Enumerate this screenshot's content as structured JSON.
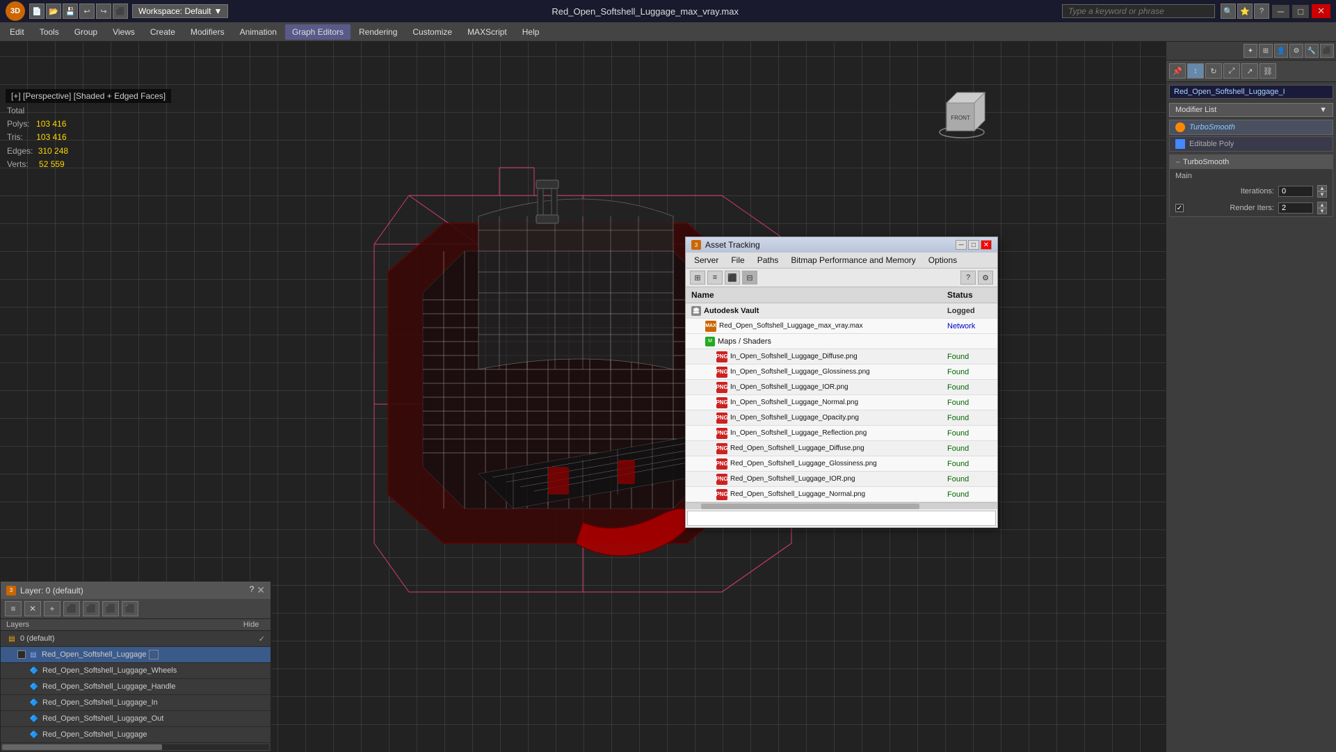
{
  "titlebar": {
    "filename": "Red_Open_Softshell_Luggage_max_vray.max",
    "workspace_label": "Workspace: Default",
    "search_placeholder": "Type a keyword or phrase",
    "min_btn": "─",
    "max_btn": "□",
    "close_btn": "✕"
  },
  "menubar": {
    "items": [
      {
        "label": "Edit",
        "active": false
      },
      {
        "label": "Tools",
        "active": false
      },
      {
        "label": "Group",
        "active": false
      },
      {
        "label": "Views",
        "active": false
      },
      {
        "label": "Create",
        "active": false
      },
      {
        "label": "Modifiers",
        "active": false
      },
      {
        "label": "Animation",
        "active": false
      },
      {
        "label": "Graph Editors",
        "active": true
      },
      {
        "label": "Rendering",
        "active": false
      },
      {
        "label": "Customize",
        "active": false
      },
      {
        "label": "MAXScript",
        "active": false
      },
      {
        "label": "Help",
        "active": false
      }
    ]
  },
  "viewport": {
    "label": "[+] [Perspective] [Shaded + Edged Faces]"
  },
  "stats": {
    "total_label": "Total",
    "polys_label": "Polys:",
    "polys_value": "103 416",
    "tris_label": "Tris:",
    "tris_value": "103 416",
    "edges_label": "Edges:",
    "edges_value": "310 248",
    "verts_label": "Verts:",
    "verts_value": "52 559"
  },
  "right_panel": {
    "object_name": "Red_Open_Softshell_Luggage_I",
    "modifier_list_label": "Modifier List",
    "modifiers": [
      {
        "name": "TurboSmooth",
        "type": "ts",
        "italic": true
      },
      {
        "name": "Editable Poly",
        "type": "ep",
        "italic": false
      }
    ],
    "turbosmooth": {
      "section": "TurboSmooth",
      "subsection": "Main",
      "iterations_label": "Iterations:",
      "iterations_value": "0",
      "render_iters_label": "Render Iters:",
      "render_iters_value": "2",
      "render_iters_checked": true
    }
  },
  "layers_panel": {
    "title": "Layer: 0 (default)",
    "help_btn": "?",
    "toolbar_icons": [
      "≡",
      "✕",
      "+",
      "⬛",
      "⬛",
      "⬛",
      "⬛"
    ],
    "col_layers": "Layers",
    "col_hide": "Hide",
    "items": [
      {
        "name": "0 (default)",
        "indent": 0,
        "type": "default",
        "checked": true,
        "selected": false
      },
      {
        "name": "Red_Open_Softshell_Luggage",
        "indent": 1,
        "type": "layer",
        "checked": false,
        "selected": true
      },
      {
        "name": "Red_Open_Softshell_Luggage_Wheels",
        "indent": 2,
        "type": "layer",
        "checked": false,
        "selected": false
      },
      {
        "name": "Red_Open_Softshell_Luggage_Handle",
        "indent": 2,
        "type": "layer",
        "checked": false,
        "selected": false
      },
      {
        "name": "Red_Open_Softshell_Luggage_In",
        "indent": 2,
        "type": "layer",
        "checked": false,
        "selected": false
      },
      {
        "name": "Red_Open_Softshell_Luggage_Out",
        "indent": 2,
        "type": "layer",
        "checked": false,
        "selected": false
      },
      {
        "name": "Red_Open_Softshell_Luggage",
        "indent": 2,
        "type": "layer",
        "checked": false,
        "selected": false
      }
    ]
  },
  "asset_panel": {
    "title": "Asset Tracking",
    "menus": [
      "Server",
      "File",
      "Paths",
      "Bitmap Performance and Memory",
      "Options"
    ],
    "col_name": "Name",
    "col_status": "Status",
    "rows": [
      {
        "name": "Autodesk Vault",
        "type": "vault",
        "status": "Logged",
        "status_class": "status-logged",
        "indent": 0
      },
      {
        "name": "Red_Open_Softshell_Luggage_max_vray.max",
        "type": "max",
        "status": "Network",
        "status_class": "status-network",
        "indent": 1
      },
      {
        "name": "Maps / Shaders",
        "type": "maps",
        "status": "",
        "status_class": "",
        "indent": 1
      },
      {
        "name": "In_Open_Softshell_Luggage_Diffuse.png",
        "type": "png",
        "status": "Found",
        "status_class": "status-found",
        "indent": 2
      },
      {
        "name": "In_Open_Softshell_Luggage_Glossiness.png",
        "type": "png",
        "status": "Found",
        "status_class": "status-found",
        "indent": 2
      },
      {
        "name": "In_Open_Softshell_Luggage_IOR.png",
        "type": "png",
        "status": "Found",
        "status_class": "status-found",
        "indent": 2
      },
      {
        "name": "In_Open_Softshell_Luggage_Normal.png",
        "type": "png",
        "status": "Found",
        "status_class": "status-found",
        "indent": 2
      },
      {
        "name": "In_Open_Softshell_Luggage_Opacity.png",
        "type": "png",
        "status": "Found",
        "status_class": "status-found",
        "indent": 2
      },
      {
        "name": "In_Open_Softshell_Luggage_Reflection.png",
        "type": "png",
        "status": "Found",
        "status_class": "status-found",
        "indent": 2
      },
      {
        "name": "Red_Open_Softshell_Luggage_Diffuse.png",
        "type": "png",
        "status": "Found",
        "status_class": "status-found",
        "indent": 2
      },
      {
        "name": "Red_Open_Softshell_Luggage_Glossiness.png",
        "type": "png",
        "status": "Found",
        "status_class": "status-found",
        "indent": 2
      },
      {
        "name": "Red_Open_Softshell_Luggage_IOR.png",
        "type": "png",
        "status": "Found",
        "status_class": "status-found",
        "indent": 2
      },
      {
        "name": "Red_Open_Softshell_Luggage_Normal.png",
        "type": "png",
        "status": "Found",
        "status_class": "status-found",
        "indent": 2
      }
    ]
  }
}
